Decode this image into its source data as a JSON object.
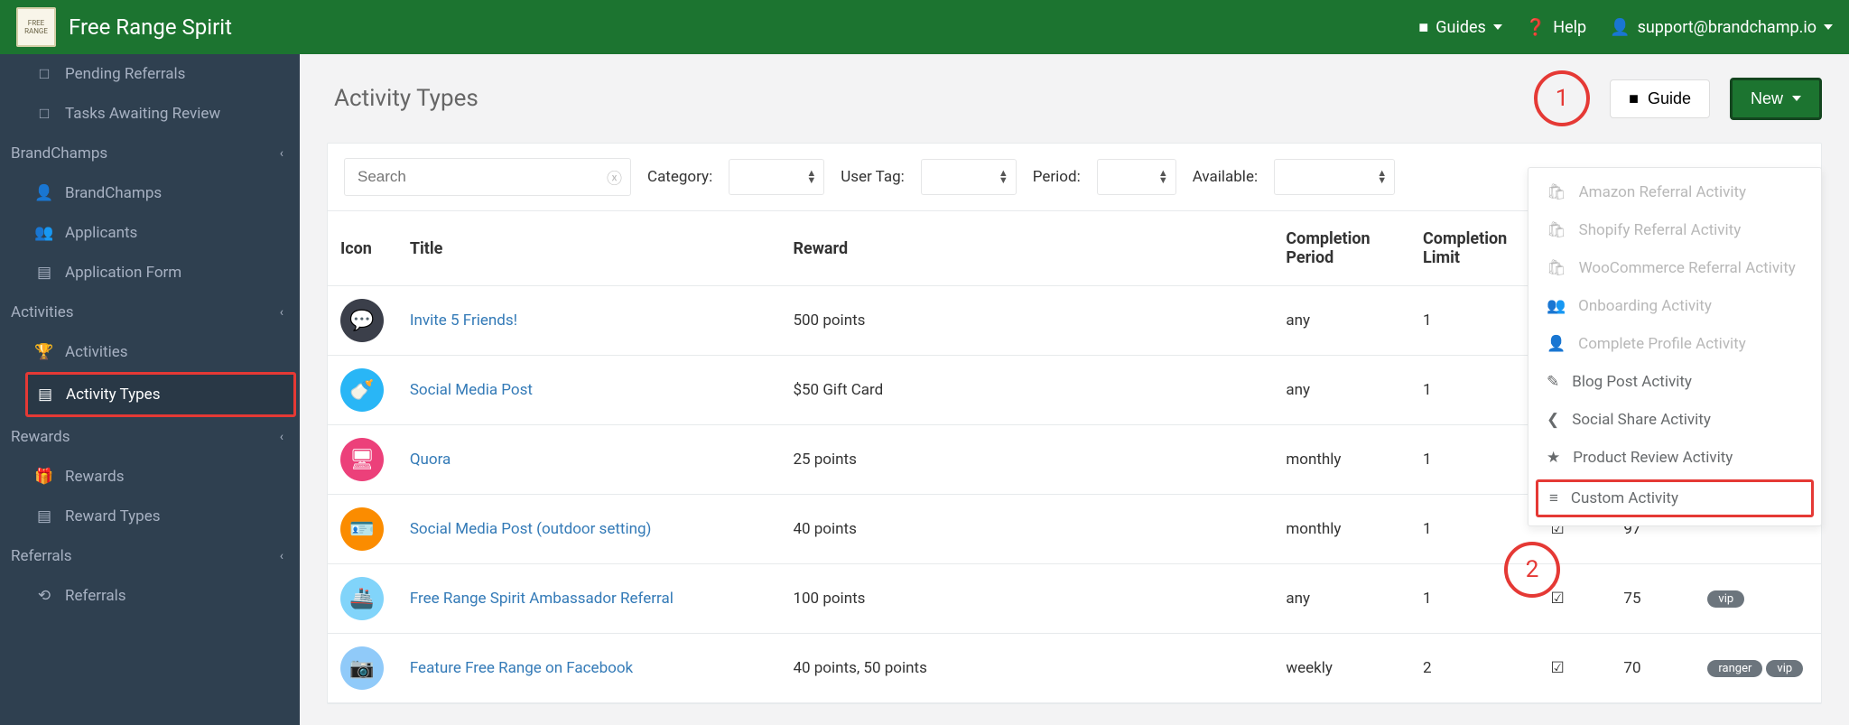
{
  "brand": "Free Range Spirit",
  "topnav": {
    "guides": "Guides",
    "help": "Help",
    "user": "support@brandchamp.io"
  },
  "sidebar": {
    "items": [
      {
        "icon": "□",
        "label": "Pending Referrals"
      },
      {
        "icon": "□",
        "label": "Tasks Awaiting Review"
      }
    ],
    "groups": [
      {
        "label": "BrandChamps",
        "children": [
          {
            "icon": "👤",
            "label": "BrandChamps"
          },
          {
            "icon": "👥",
            "label": "Applicants"
          },
          {
            "icon": "▤",
            "label": "Application Form"
          }
        ]
      },
      {
        "label": "Activities",
        "children": [
          {
            "icon": "🏆",
            "label": "Activities"
          },
          {
            "icon": "▤",
            "label": "Activity Types",
            "active": true
          }
        ]
      },
      {
        "label": "Rewards",
        "children": [
          {
            "icon": "🎁",
            "label": "Rewards"
          },
          {
            "icon": "▤",
            "label": "Reward Types"
          }
        ]
      },
      {
        "label": "Referrals",
        "children": [
          {
            "icon": "⟲",
            "label": "Referrals"
          }
        ]
      }
    ]
  },
  "page": {
    "title": "Activity Types",
    "guide_btn": "Guide",
    "new_btn": "New"
  },
  "annotations": {
    "one": "1",
    "two": "2"
  },
  "filters": {
    "search_placeholder": "Search",
    "category": "Category:",
    "user_tag": "User Tag:",
    "period": "Period:",
    "available": "Available:"
  },
  "table": {
    "headers": {
      "icon": "Icon",
      "title": "Title",
      "reward": "Reward",
      "period": "Completion Period",
      "limit": "Completion Limit"
    },
    "rows": [
      {
        "bg": "#3b3f4a",
        "emoji": "💬",
        "title": "Invite 5 Friends!",
        "reward": "500 points",
        "period": "any",
        "limit": "1",
        "chk": "",
        "num": "",
        "tags": []
      },
      {
        "bg": "#29b6f6",
        "emoji": "🍼",
        "title": "Social Media Post",
        "reward": "$50 Gift Card",
        "period": "any",
        "limit": "1",
        "chk": "",
        "num": "",
        "tags": []
      },
      {
        "bg": "#ec407a",
        "emoji": "🖥",
        "title": "Quora",
        "reward": "25 points",
        "period": "monthly",
        "limit": "1",
        "chk": "",
        "num": "",
        "tags": []
      },
      {
        "bg": "#fb8c00",
        "emoji": "🪪",
        "title": "Social Media Post (outdoor setting)",
        "reward": "40 points",
        "period": "monthly",
        "limit": "1",
        "chk": "✔",
        "num": "97",
        "tags": []
      },
      {
        "bg": "#81d4fa",
        "emoji": "🚢",
        "title": "Free Range Spirit Ambassador Referral",
        "reward": "100 points",
        "period": "any",
        "limit": "1",
        "chk": "✔",
        "num": "75",
        "tags": [
          "vip"
        ]
      },
      {
        "bg": "#90caf9",
        "emoji": "📷",
        "title": "Feature Free Range on Facebook",
        "reward": "40 points, 50 points",
        "period": "weekly",
        "limit": "2",
        "chk": "✔",
        "num": "70",
        "tags": [
          "ranger",
          "vip"
        ]
      }
    ]
  },
  "dropdown": [
    {
      "icon": "🛍",
      "label": "Amazon Referral Activity",
      "disabled": true
    },
    {
      "icon": "🛍",
      "label": "Shopify Referral Activity",
      "disabled": true
    },
    {
      "icon": "🛍",
      "label": "WooCommerce Referral Activity",
      "disabled": true
    },
    {
      "icon": "👥",
      "label": "Onboarding Activity",
      "disabled": true
    },
    {
      "icon": "👤",
      "label": "Complete Profile Activity",
      "disabled": true
    },
    {
      "icon": "✎",
      "label": "Blog Post Activity",
      "disabled": false
    },
    {
      "icon": "❮",
      "label": "Social Share Activity",
      "disabled": false
    },
    {
      "icon": "★",
      "label": "Product Review Activity",
      "disabled": false
    },
    {
      "icon": "≡",
      "label": "Custom Activity",
      "disabled": false,
      "boxed": true
    }
  ]
}
